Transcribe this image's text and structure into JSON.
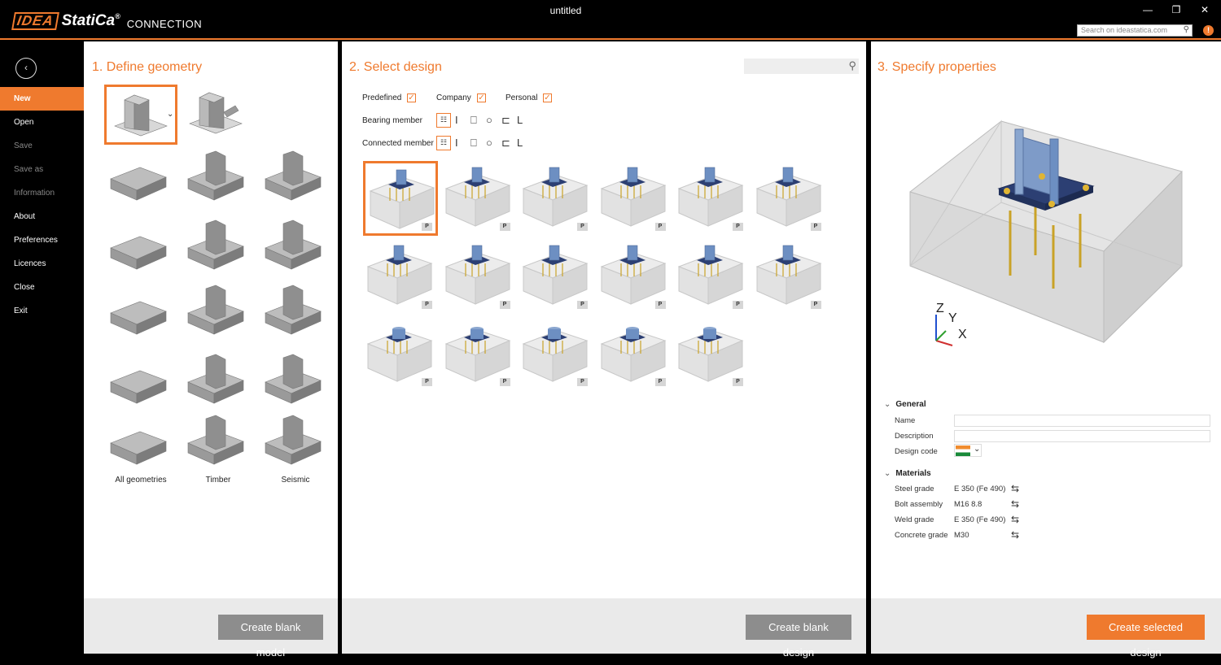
{
  "app": {
    "brand_idea": "IDEA",
    "brand_statica": "StatiCa",
    "brand_reg": "®",
    "product": "CONNECTION",
    "window_title": "untitled"
  },
  "window_controls": {
    "minimize": "—",
    "restore": "❐",
    "close": "✕"
  },
  "web_search": {
    "placeholder": "Search on ideastatica.com"
  },
  "sidebar": {
    "back_icon": "‹",
    "items": [
      {
        "label": "New",
        "state": "active"
      },
      {
        "label": "Open",
        "state": "enabled"
      },
      {
        "label": "Save",
        "state": "disabled"
      },
      {
        "label": "Save as",
        "state": "disabled"
      },
      {
        "label": "Information",
        "state": "disabled"
      },
      {
        "label": "About",
        "state": "enabled"
      },
      {
        "label": "Preferences",
        "state": "enabled"
      },
      {
        "label": "Licences",
        "state": "enabled"
      },
      {
        "label": "Close",
        "state": "enabled"
      },
      {
        "label": "Exit",
        "state": "enabled"
      }
    ]
  },
  "panel1": {
    "title": "1. Define geometry",
    "geometry_labels": [
      "All geometries",
      "Timber",
      "Seismic"
    ],
    "create_button": "Create blank model"
  },
  "panel2": {
    "title": "2. Select design",
    "filters": {
      "predefined": "Predefined",
      "company": "Company",
      "personal": "Personal",
      "bearing_member": "Bearing member",
      "connected_member": "Connected member"
    },
    "checkmark": "✓",
    "shapes": [
      "I",
      "⎕",
      "○",
      "⊏",
      "L"
    ],
    "list_icon": "☷",
    "tag": "P",
    "create_button": "Create blank design"
  },
  "panel3": {
    "title": "3. Specify properties",
    "axes": {
      "z": "Z",
      "y": "Y",
      "x": "X"
    },
    "general": {
      "header": "General",
      "name_label": "Name",
      "description_label": "Description",
      "design_code_label": "Design code"
    },
    "materials": {
      "header": "Materials",
      "rows": [
        {
          "label": "Steel grade",
          "value": "E 350 (Fe 490)"
        },
        {
          "label": "Bolt assembly",
          "value": "M16 8.8"
        },
        {
          "label": "Weld grade",
          "value": "E 350 (Fe 490)"
        },
        {
          "label": "Concrete grade",
          "value": "M30"
        }
      ]
    },
    "swap_icon": "⇆",
    "create_button": "Create selected design"
  },
  "colors": {
    "accent": "#ef7a2e",
    "steel": "#6d8fc2",
    "plate": "#2c3f73",
    "concrete": "#e0e0e0"
  }
}
